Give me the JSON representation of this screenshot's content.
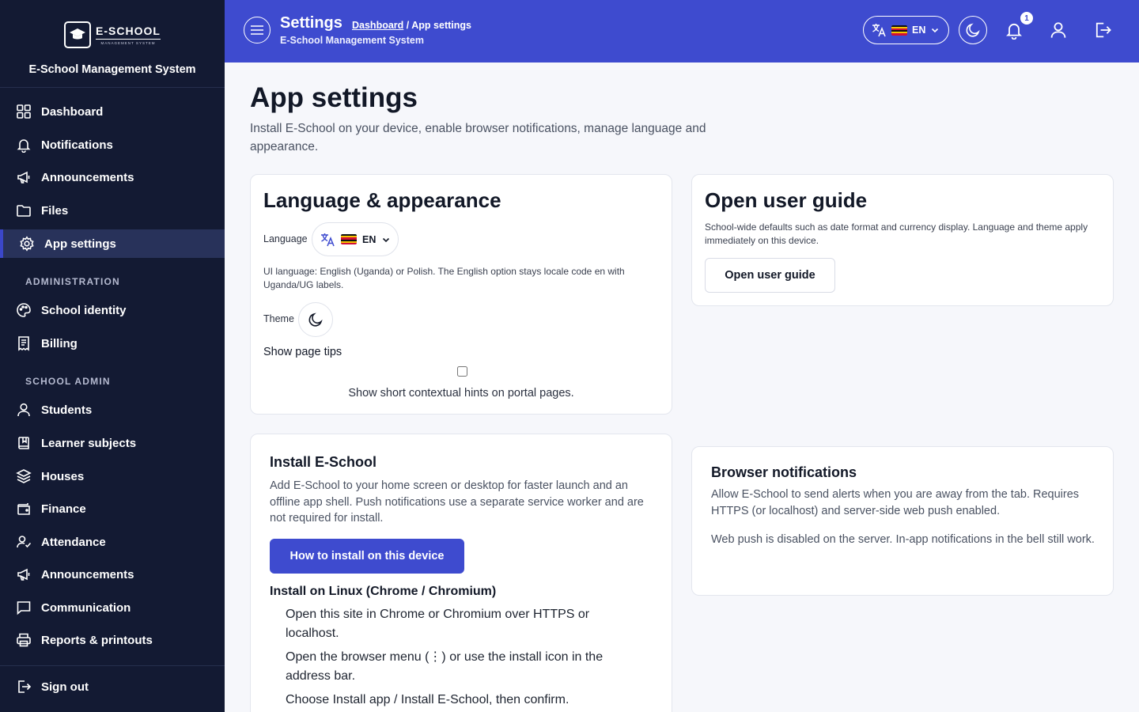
{
  "sidebar": {
    "logo_text": "E-SCHOOL",
    "logo_sub": "MANAGEMENT SYSTEM",
    "app_name": "E-School Management System",
    "items": [
      {
        "label": "Dashboard",
        "icon": "dashboard-icon"
      },
      {
        "label": "Notifications",
        "icon": "bell-icon"
      },
      {
        "label": "Announcements",
        "icon": "megaphone-icon"
      },
      {
        "label": "Files",
        "icon": "folder-icon"
      },
      {
        "label": "App settings",
        "icon": "gear-icon"
      }
    ],
    "section_admin": "ADMINISTRATION",
    "admin_items": [
      {
        "label": "School identity",
        "icon": "palette-icon"
      },
      {
        "label": "Billing",
        "icon": "receipt-icon"
      }
    ],
    "section_school": "SCHOOL ADMIN",
    "school_items": [
      {
        "label": "Students",
        "icon": "user-icon"
      },
      {
        "label": "Learner subjects",
        "icon": "book-icon"
      },
      {
        "label": "Houses",
        "icon": "layers-icon"
      },
      {
        "label": "Finance",
        "icon": "wallet-icon"
      },
      {
        "label": "Attendance",
        "icon": "user-check-icon"
      },
      {
        "label": "Announcements",
        "icon": "megaphone-icon"
      },
      {
        "label": "Communication",
        "icon": "chat-icon"
      },
      {
        "label": "Reports & printouts",
        "icon": "printer-icon"
      }
    ],
    "sign_out": "Sign out"
  },
  "topbar": {
    "title": "Settings",
    "breadcrumb_link": "Dashboard",
    "breadcrumb_sep": " / ",
    "breadcrumb_current": "App settings",
    "subtitle": "E-School Management System",
    "lang_code": "EN",
    "notification_count": "1"
  },
  "page": {
    "title": "App settings",
    "description": "Install E-School on your device, enable browser notifications, manage language and appearance."
  },
  "lang_card": {
    "title": "Language & appearance",
    "language_label": "Language",
    "lang_code": "EN",
    "ui_help": "UI language: English (Uganda) or Polish. The English option stays locale code en with Uganda/UG labels.",
    "theme_label": "Theme",
    "tips_label": "Show page tips",
    "tips_help": "Show short contextual hints on portal pages.",
    "tips_checked": false
  },
  "guide_card": {
    "title": "Open user guide",
    "description": "School-wide defaults such as date format and currency display. Language and theme apply immediately on this device.",
    "button": "Open user guide"
  },
  "install_card": {
    "title": "Install E-School",
    "description": "Add E-School to your home screen or desktop for faster launch and an offline app shell. Push notifications use a separate service worker and are not required for install.",
    "button": "How to install on this device",
    "linux_heading": "Install on Linux (Chrome / Chromium)",
    "steps": [
      "Open this site in Chrome or Chromium over HTTPS or localhost.",
      "Open the browser menu (⋮) or use the install icon in the address bar.",
      "Choose Install app / Install E-School, then confirm."
    ]
  },
  "push_card": {
    "title": "Browser notifications",
    "description": "Allow E-School to send alerts when you are away from the tab. Requires HTTPS (or localhost) and server-side web push enabled.",
    "status": "Web push is disabled on the server. In-app notifications in the bell still work."
  },
  "colors": {
    "sidebar_bg": "#131a33",
    "topbar_bg": "#3e4bcf",
    "accent": "#3e4bcf"
  }
}
